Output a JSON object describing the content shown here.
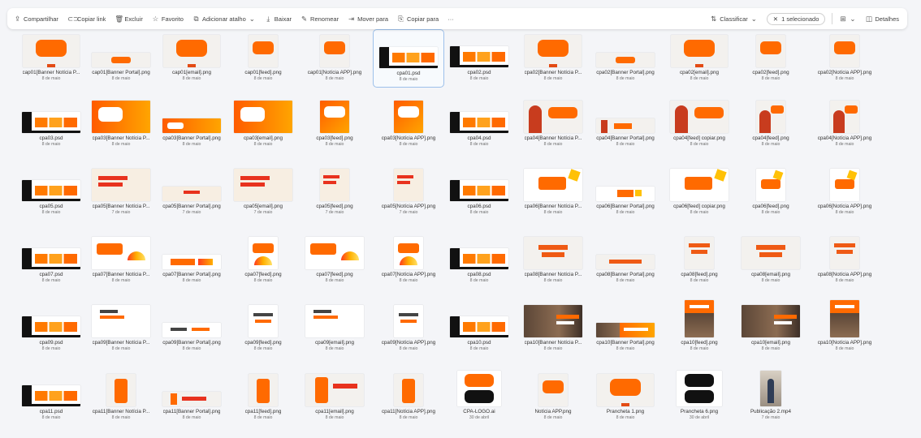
{
  "toolbar": {
    "share": "Compartilhar",
    "copy_link": "Copiar link",
    "delete": "Excluir",
    "favorite": "Favorito",
    "add_shortcut": "Adicionar atalho",
    "download": "Baixar",
    "rename": "Renomear",
    "move_to": "Mover para",
    "copy_to": "Copiar para",
    "more": "···",
    "sort": "Classificar",
    "selected": "1 selecionado",
    "details": "Detalhes"
  },
  "files": [
    {
      "name": "cap01[Banner Notícia P...",
      "date": "8 de maio",
      "thumb": "t-white"
    },
    {
      "name": "cap01[Banner Portal].png",
      "date": "8 de maio",
      "thumb": "t-wide"
    },
    {
      "name": "cap01[email].png",
      "date": "8 de maio",
      "thumb": "t-white"
    },
    {
      "name": "cap01[feed].png",
      "date": "8 de maio",
      "thumb": "t-sq"
    },
    {
      "name": "cap01[Notícia APP].png",
      "date": "8 de maio",
      "thumb": "t-sq"
    },
    {
      "name": "cpa01.psd",
      "date": "8 de maio",
      "thumb": "t-psd",
      "selected": true
    },
    {
      "name": "cpa02.psd",
      "date": "8 de maio",
      "thumb": "t-psd"
    },
    {
      "name": "cpa02[Banner Notícia P...",
      "date": "8 de maio",
      "thumb": "t-white"
    },
    {
      "name": "cpa02[Banner Portal].png",
      "date": "8 de maio",
      "thumb": "t-wide"
    },
    {
      "name": "cpa02[email].png",
      "date": "8 de maio",
      "thumb": "t-white"
    },
    {
      "name": "cpa02[feed].png",
      "date": "8 de maio",
      "thumb": "t-sq"
    },
    {
      "name": "cpa02[Notícia APP].png",
      "date": "8 de maio",
      "thumb": "t-sq"
    },
    {
      "name": "cpa03.psd",
      "date": "8 de maio",
      "thumb": "t-psd"
    },
    {
      "name": "cpa03[Banner Notícia P...",
      "date": "8 de maio",
      "thumb": "t-orange"
    },
    {
      "name": "cpa03[Banner Portal].png",
      "date": "8 de maio",
      "thumb": "t-orange-wide"
    },
    {
      "name": "cpa03[email].png",
      "date": "8 de maio",
      "thumb": "t-orange"
    },
    {
      "name": "cpa03[feed].png",
      "date": "8 de maio",
      "thumb": "t-orange-sq"
    },
    {
      "name": "cpa03[Notícia APP].png",
      "date": "8 de maio",
      "thumb": "t-orange-sq"
    },
    {
      "name": "cpa04.psd",
      "date": "8 de maio",
      "thumb": "t-psd"
    },
    {
      "name": "cpa04[Banner Notícia P...",
      "date": "8 de maio",
      "thumb": "t-man"
    },
    {
      "name": "cpa04[Banner Portal].png",
      "date": "8 de maio",
      "thumb": "t-man-wide"
    },
    {
      "name": "cpa04[feed] copiar.png",
      "date": "8 de maio",
      "thumb": "t-man"
    },
    {
      "name": "cpa04[feed].png",
      "date": "8 de maio",
      "thumb": "t-man-sq"
    },
    {
      "name": "cpa04[Notícia APP].png",
      "date": "8 de maio",
      "thumb": "t-man-sq"
    },
    {
      "name": "cpa05.psd",
      "date": "8 de maio",
      "thumb": "t-psd"
    },
    {
      "name": "cpa05[Banner Notícia P...",
      "date": "7 de maio",
      "thumb": "t-porque"
    },
    {
      "name": "cpa05[Banner Portal].png",
      "date": "7 de maio",
      "thumb": "t-porque-wide"
    },
    {
      "name": "cpa05[email].png",
      "date": "7 de maio",
      "thumb": "t-porque"
    },
    {
      "name": "cpa05[feed].png",
      "date": "7 de maio",
      "thumb": "t-porque-sq"
    },
    {
      "name": "cpa05[Notícia APP].png",
      "date": "7 de maio",
      "thumb": "t-porque-sq"
    },
    {
      "name": "cpa06.psd",
      "date": "8 de maio",
      "thumb": "t-psd"
    },
    {
      "name": "cpa06[Banner Notícia P...",
      "date": "8 de maio",
      "thumb": "t-star"
    },
    {
      "name": "cpa06[Banner Portal].png",
      "date": "8 de maio",
      "thumb": "t-star-wide"
    },
    {
      "name": "cpa06[feed] copiar.png",
      "date": "8 de maio",
      "thumb": "t-star"
    },
    {
      "name": "cpa06[feed].png",
      "date": "8 de maio",
      "thumb": "t-star-sq"
    },
    {
      "name": "cpa06[Notícia APP].png",
      "date": "8 de maio",
      "thumb": "t-star-sq"
    },
    {
      "name": "cpa07.psd",
      "date": "8 de maio",
      "thumb": "t-psd"
    },
    {
      "name": "cpa07[Banner Notícia P...",
      "date": "8 de maio",
      "thumb": "t-gauge"
    },
    {
      "name": "cpa07[Banner Portal].png",
      "date": "8 de maio",
      "thumb": "t-gauge-wide"
    },
    {
      "name": "cpa07[feed].png",
      "date": "8 de maio",
      "thumb": "t-gauge-sq"
    },
    {
      "name": "cpa07[feed].png",
      "date": "8 de maio",
      "thumb": "t-gauge"
    },
    {
      "name": "cpa07[Notícia APP].png",
      "date": "8 de maio",
      "thumb": "t-gauge-sq"
    },
    {
      "name": "cpa08.psd",
      "date": "8 de maio",
      "thumb": "t-psd"
    },
    {
      "name": "cpa08[Banner Notícia P...",
      "date": "8 de maio",
      "thumb": "t-tenho"
    },
    {
      "name": "cpa08[Banner Portal].png",
      "date": "8 de maio",
      "thumb": "t-tenho-wide"
    },
    {
      "name": "cpa08[feed].png",
      "date": "8 de maio",
      "thumb": "t-tenho-sq"
    },
    {
      "name": "cpa08[email].png",
      "date": "8 de maio",
      "thumb": "t-tenho"
    },
    {
      "name": "cpa08[Notícia APP].png",
      "date": "8 de maio",
      "thumb": "t-tenho-sq"
    },
    {
      "name": "cpa09.psd",
      "date": "8 de maio",
      "thumb": "t-psd"
    },
    {
      "name": "cpa09[Banner Notícia P...",
      "date": "8 de maio",
      "thumb": "t-card"
    },
    {
      "name": "cpa09[Banner Portal].png",
      "date": "8 de maio",
      "thumb": "t-card-wide"
    },
    {
      "name": "cpa09[feed].png",
      "date": "8 de maio",
      "thumb": "t-card-sq"
    },
    {
      "name": "cpa09[email].png",
      "date": "8 de maio",
      "thumb": "t-card"
    },
    {
      "name": "cpa09[Notícia APP].png",
      "date": "8 de maio",
      "thumb": "t-card-sq"
    },
    {
      "name": "cpa10.psd",
      "date": "8 de maio",
      "thumb": "t-psd"
    },
    {
      "name": "cpa10[Banner Notícia P...",
      "date": "8 de maio",
      "thumb": "t-photo"
    },
    {
      "name": "cpa10[Banner Portal].png",
      "date": "8 de maio",
      "thumb": "t-photo-wide"
    },
    {
      "name": "cpa10[feed].png",
      "date": "8 de maio",
      "thumb": "t-photo-sq"
    },
    {
      "name": "cpa10[email].png",
      "date": "8 de maio",
      "thumb": "t-photo"
    },
    {
      "name": "cpa10[Notícia APP].png",
      "date": "8 de maio",
      "thumb": "t-photo-sq"
    },
    {
      "name": "cpa11.psd",
      "date": "8 de maio",
      "thumb": "t-psd"
    },
    {
      "name": "cpa11[Banner Notícia P...",
      "date": "8 de maio",
      "thumb": "t-phone-sq"
    },
    {
      "name": "cpa11[Banner Portal].png",
      "date": "8 de maio",
      "thumb": "t-phone-wide"
    },
    {
      "name": "cpa11[feed].png",
      "date": "8 de maio",
      "thumb": "t-phone-sq"
    },
    {
      "name": "cpa11[email].png",
      "date": "8 de maio",
      "thumb": "t-phone"
    },
    {
      "name": "cpa11[Notícia APP].png",
      "date": "8 de maio",
      "thumb": "t-phone-sq"
    },
    {
      "name": "CPA-LOGO.ai",
      "date": "30 de abril",
      "thumb": "t-logo"
    },
    {
      "name": "Notícia APP.png",
      "date": "8 de maio",
      "thumb": "t-sq"
    },
    {
      "name": "Prancheta 1.png",
      "date": "8 de maio",
      "thumb": "t-white"
    },
    {
      "name": "Prancheta 6.png",
      "date": "30 de abril",
      "thumb": "t-logo-bw"
    },
    {
      "name": "Publicação 2.mp4",
      "date": "7 de maio",
      "thumb": "t-mp4"
    }
  ]
}
